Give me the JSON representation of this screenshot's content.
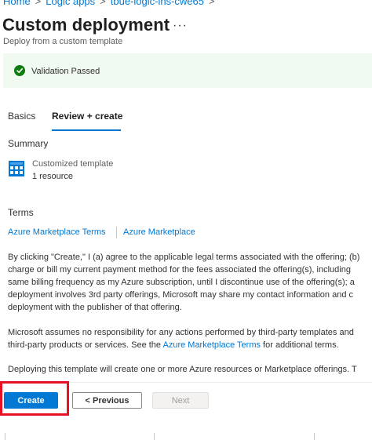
{
  "breadcrumb": {
    "items": [
      "Home",
      "Logic apps",
      "tbue-logic-ins-cwe65"
    ],
    "separator": ">"
  },
  "header": {
    "title": "Custom deployment",
    "more": "···",
    "subtitle": "Deploy from a custom template"
  },
  "validation": {
    "text": "Validation Passed",
    "icon": "check-circle-icon",
    "color": "#107c10"
  },
  "tabs": [
    {
      "label": "Basics",
      "active": false
    },
    {
      "label": "Review + create",
      "active": true
    }
  ],
  "summary": {
    "heading": "Summary",
    "icon": "template-grid-icon",
    "title": "Customized template",
    "count": "1 resource"
  },
  "terms": {
    "heading": "Terms",
    "links": [
      "Azure Marketplace Terms",
      "Azure Marketplace"
    ],
    "para1": [
      "By clicking \"Create,\" I (a) agree to the applicable legal terms associated with the offering; (b)",
      "charge or bill my current payment method for the fees associated the offering(s), including",
      "same billing frequency as my Azure subscription, until I discontinue use of the offering(s); a",
      "deployment involves 3rd party offerings, Microsoft may share my contact information and c",
      "deployment with the publisher of that offering."
    ],
    "para2_line1": "Microsoft assumes no responsibility for any actions performed by third-party templates and",
    "para2_line2_pre": "third-party products or services. See the ",
    "para2_line2_link": "Azure Marketplace Terms",
    "para2_line2_post": " for additional terms.",
    "para3": "Deploying this template will create one or more Azure resources or Marketplace offerings. T"
  },
  "footer": {
    "create_label": "Create",
    "previous_label": "< Previous",
    "next_label": "Next"
  },
  "colors": {
    "accent": "#0078d4",
    "highlight": "#e81123",
    "banner_bg": "#f1faf1"
  }
}
